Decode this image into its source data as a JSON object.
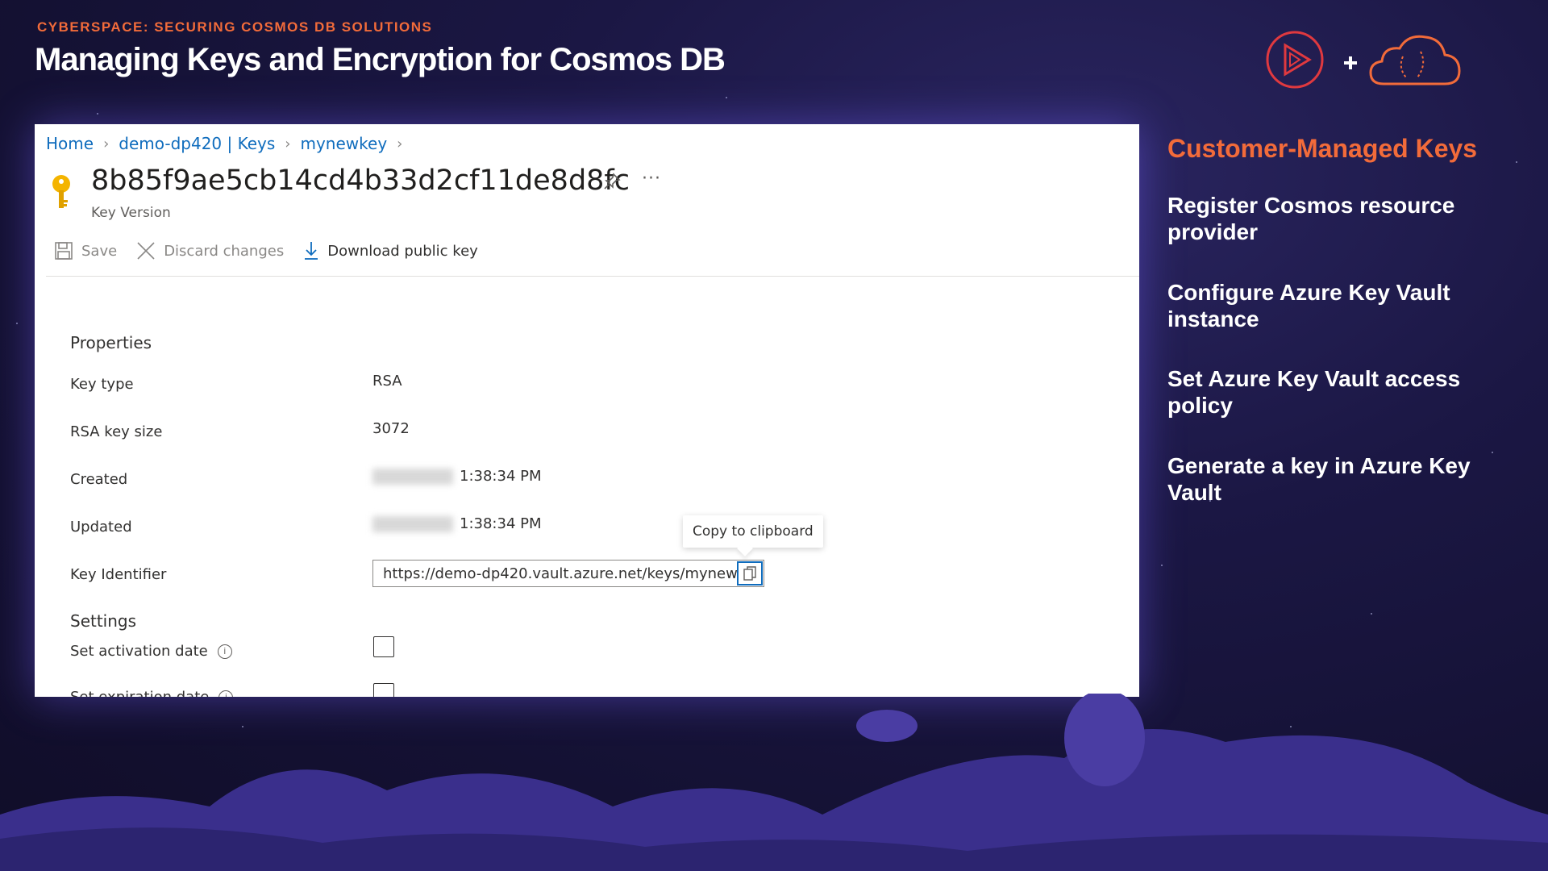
{
  "header": {
    "course_label": "CYBERSPACE: SECURING COSMOS DB SOLUTIONS",
    "title": "Managing Keys and Encryption for Cosmos DB",
    "logos": [
      "play-logo-icon",
      "plus-icon",
      "cloud-brain-logo-icon"
    ]
  },
  "portal": {
    "breadcrumb": [
      "Home",
      "demo-dp420 | Keys",
      "mynewkey"
    ],
    "key_version_id": "8b85f9ae5cb14cd4b33d2cf11de8d8fc",
    "subtitle": "Key Version",
    "more_label": "···",
    "toolbar": {
      "save": "Save",
      "discard": "Discard changes",
      "download": "Download public key"
    },
    "properties_heading": "Properties",
    "properties": {
      "key_type_label": "Key type",
      "key_type_value": "RSA",
      "rsa_size_label": "RSA key size",
      "rsa_size_value": "3072",
      "created_label": "Created",
      "created_time": "1:38:34 PM",
      "updated_label": "Updated",
      "updated_time": "1:38:34 PM",
      "key_identifier_label": "Key Identifier",
      "key_identifier_value": "https://demo-dp420.vault.azure.net/keys/mynew..."
    },
    "tooltip": "Copy to clipboard",
    "settings_heading": "Settings",
    "settings": {
      "activation_label": "Set activation date",
      "activation_checked": false,
      "expiration_label": "Set expiration date",
      "expiration_checked": false
    }
  },
  "side_panel": {
    "title": "Customer-Managed Keys",
    "items": [
      "Register Cosmos resource provider",
      "Configure Azure Key Vault instance",
      "Set Azure Key Vault access policy",
      "Generate a key in Azure Key Vault"
    ]
  },
  "colors": {
    "accent_orange": "#f26b3a",
    "azure_link": "#0f6cbd",
    "background": "#1b1744"
  }
}
